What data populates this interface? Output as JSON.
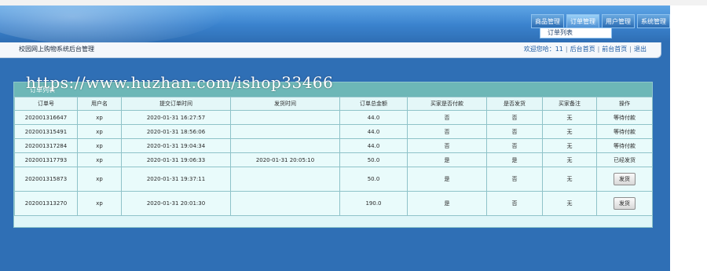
{
  "nav": {
    "items": [
      {
        "label": "商品管理"
      },
      {
        "label": "订单管理"
      },
      {
        "label": "用户管理"
      },
      {
        "label": "系统管理"
      }
    ],
    "dropdown_item": "订单列表"
  },
  "header": {
    "site_title": "校园网上购物系统后台管理",
    "welcome": "欢迎您哈：11",
    "link_backend_home": "后台首页",
    "link_frontend_home": "前台首页",
    "link_logout": "退出"
  },
  "watermark": "https://www.huzhan.com/ishop33466",
  "panel": {
    "title": "订单列表"
  },
  "table": {
    "columns": [
      "订单号",
      "用户名",
      "提交订单时间",
      "发货时间",
      "订单总金额",
      "买家是否付款",
      "是否发货",
      "买家备注",
      "操作"
    ],
    "rows": [
      {
        "order_no": "202001316647",
        "user": "xp",
        "submit_time": "2020-01-31 16:27:57",
        "ship_time": "",
        "amount": "44.0",
        "paid": "否",
        "shipped": "否",
        "note": "无",
        "action": "等待付款",
        "button": false
      },
      {
        "order_no": "202001315491",
        "user": "xp",
        "submit_time": "2020-01-31 18:56:06",
        "ship_time": "",
        "amount": "44.0",
        "paid": "否",
        "shipped": "否",
        "note": "无",
        "action": "等待付款",
        "button": false
      },
      {
        "order_no": "202001317284",
        "user": "xp",
        "submit_time": "2020-01-31 19:04:34",
        "ship_time": "",
        "amount": "44.0",
        "paid": "否",
        "shipped": "否",
        "note": "无",
        "action": "等待付款",
        "button": false
      },
      {
        "order_no": "202001317793",
        "user": "xp",
        "submit_time": "2020-01-31 19:06:33",
        "ship_time": "2020-01-31 20:05:10",
        "amount": "50.0",
        "paid": "是",
        "shipped": "是",
        "note": "无",
        "action": "已经发货",
        "button": false
      },
      {
        "order_no": "202001315873",
        "user": "xp",
        "submit_time": "2020-01-31 19:37:11",
        "ship_time": "",
        "amount": "50.0",
        "paid": "是",
        "shipped": "否",
        "note": "无",
        "action": "发货",
        "button": true
      },
      {
        "order_no": "202001313270",
        "user": "xp",
        "submit_time": "2020-01-31 20:01:30",
        "ship_time": "",
        "amount": "190.0",
        "paid": "是",
        "shipped": "否",
        "note": "无",
        "action": "发货",
        "button": true
      }
    ]
  }
}
